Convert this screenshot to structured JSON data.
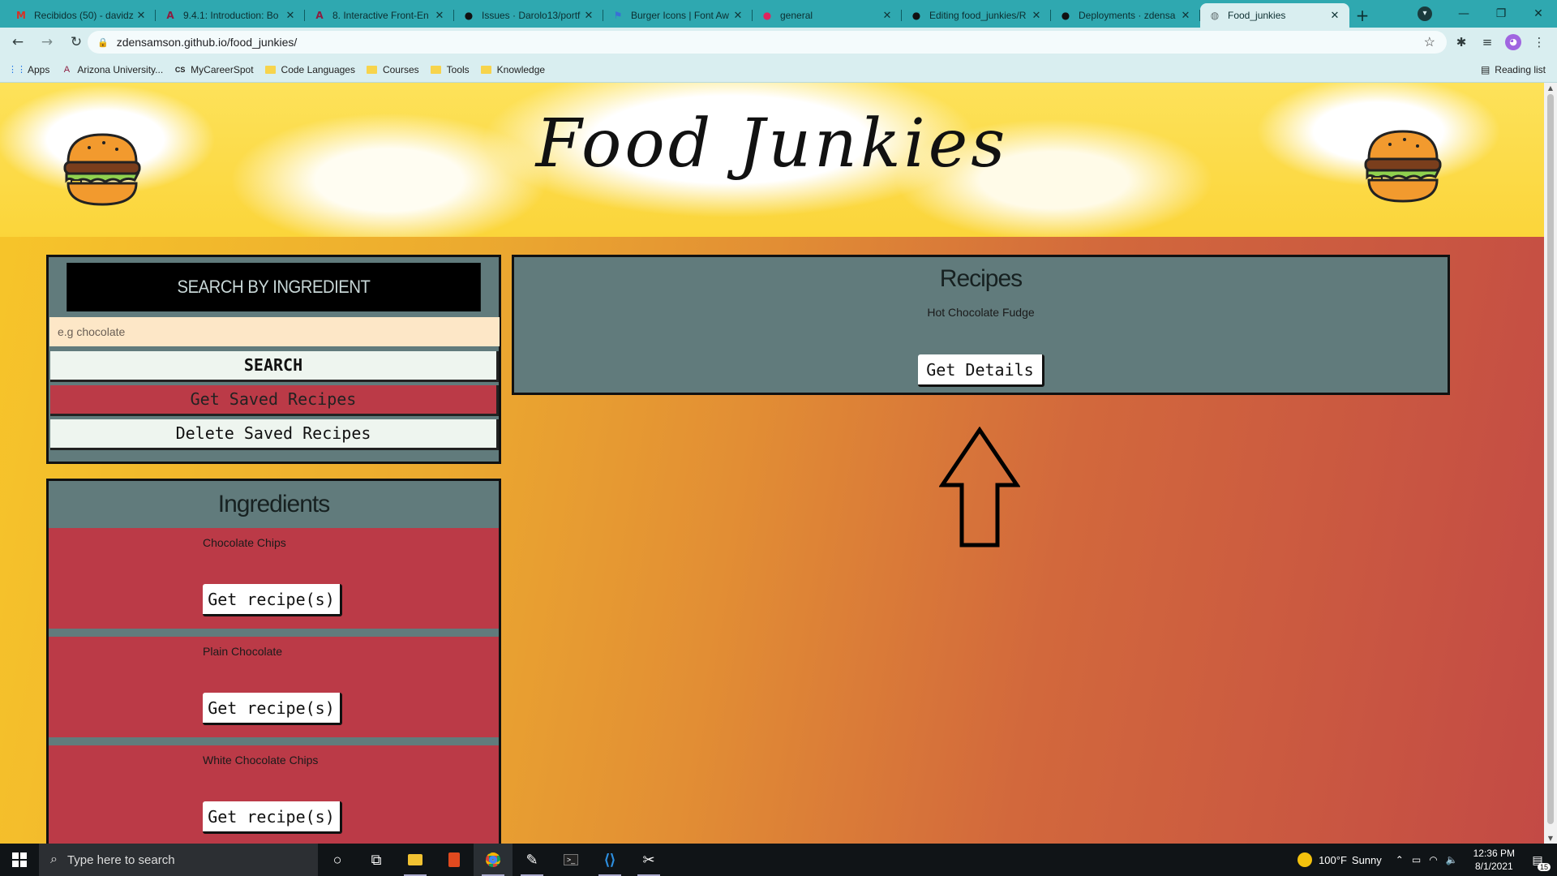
{
  "browser": {
    "tabs": [
      {
        "label": "Recibidos (50) - davidz",
        "icon": "gmail-icon",
        "glyph": "M",
        "color": "#d93025"
      },
      {
        "label": "9.4.1: Introduction: Bo",
        "icon": "asu-icon",
        "glyph": "A",
        "color": "#8c1d40"
      },
      {
        "label": "8. Interactive Front-En",
        "icon": "asu-icon",
        "glyph": "A",
        "color": "#8c1d40"
      },
      {
        "label": "Issues · Darolo13/portf",
        "icon": "github-icon",
        "glyph": "●",
        "color": "#111"
      },
      {
        "label": "Burger Icons | Font Aw",
        "icon": "flag-icon",
        "glyph": "⚑",
        "color": "#3a6fd6"
      },
      {
        "label": "general",
        "icon": "chat-icon",
        "glyph": "●",
        "color": "#e0245e"
      },
      {
        "label": "Editing food_junkies/R",
        "icon": "github-icon",
        "glyph": "●",
        "color": "#111"
      },
      {
        "label": "Deployments · zdensa",
        "icon": "github-icon",
        "glyph": "●",
        "color": "#111"
      },
      {
        "label": "Food_junkies",
        "icon": "globe-icon",
        "glyph": "◍",
        "color": "#5f6b6c",
        "active": true
      }
    ],
    "new_tab": "+",
    "url": "zdensamson.github.io/food_junkies/",
    "bookmarks": [
      {
        "label": "Apps",
        "icon": "apps-icon",
        "folder": false
      },
      {
        "label": "Arizona University...",
        "icon": "asu-icon",
        "folder": false
      },
      {
        "label": "MyCareerSpot",
        "icon": "cs-icon",
        "folder": false
      },
      {
        "label": "Code Languages",
        "icon": "folder-icon",
        "folder": true
      },
      {
        "label": "Courses",
        "icon": "folder-icon",
        "folder": true
      },
      {
        "label": "Tools",
        "icon": "folder-icon",
        "folder": true
      },
      {
        "label": "Knowledge",
        "icon": "folder-icon",
        "folder": true
      }
    ],
    "reading_list": "Reading list"
  },
  "site": {
    "title": "Food Junkies",
    "search": {
      "heading": "SEARCH BY INGREDIENT",
      "placeholder": "e.g chocolate",
      "search_label": "SEARCH",
      "get_saved_label": "Get Saved Recipes",
      "delete_saved_label": "Delete Saved Recipes"
    },
    "ingredients": {
      "heading": "Ingredients",
      "button_label": "Get recipe(s)",
      "items": [
        "Chocolate Chips",
        "Plain Chocolate",
        "White Chocolate Chips"
      ]
    },
    "recipes": {
      "heading": "Recipes",
      "items": [
        "Hot Chocolate Fudge"
      ],
      "details_label": "Get Details"
    }
  },
  "taskbar": {
    "search_placeholder": "Type here to search",
    "weather_temp": "100°F",
    "weather_text": "Sunny",
    "time": "12:36 PM",
    "date": "8/1/2021",
    "notification_count": "15"
  },
  "colors": {
    "panel": "#617b7c",
    "accent_red": "#bb3a47",
    "chrome": "#2fa8b0"
  }
}
